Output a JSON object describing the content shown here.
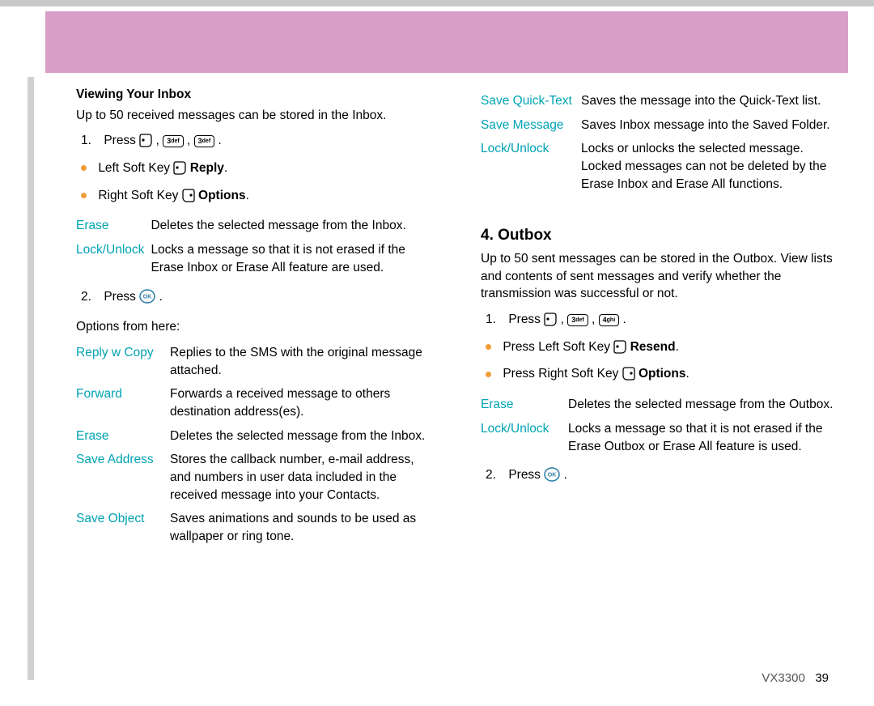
{
  "section1": {
    "heading": "Viewing Your Inbox",
    "intro": "Up to 50 received messages can be stored in the Inbox.",
    "step1_press": "Press ",
    "step1_num": "1.",
    "left_soft": "Left Soft Key ",
    "reply": "Reply",
    "right_soft": "Right Soft Key ",
    "options": "Options",
    "erase": "Erase",
    "erase_desc": "Deletes the selected message from the Inbox.",
    "lockunlock": "Lock/Unlock",
    "lockunlock_desc1": "Locks a message so that it is not erased if the",
    "lockunlock_desc2": "Erase Inbox or Erase All feature are used.",
    "step2_num": "2.",
    "step2_press": "Press ",
    "options_from": "Options from here:",
    "table": [
      {
        "t": "Reply w Copy",
        "d": "Replies to the SMS with the original message attached."
      },
      {
        "t": "Forward",
        "d": "Forwards a received message to others destination address(es)."
      },
      {
        "t": "Erase",
        "d": "Deletes the selected message from the Inbox."
      },
      {
        "t": "Save Address",
        "d": "Stores the callback number, e-mail address, and numbers in user data included in the received message into your Contacts."
      },
      {
        "t": "Save Object",
        "d": "Saves animations and sounds to be used as wallpaper or ring tone."
      }
    ]
  },
  "section1_cont": {
    "table": [
      {
        "t": "Save Quick-Text",
        "d": "Saves the message into the Quick-Text list."
      },
      {
        "t": "Save Message",
        "d": "Saves Inbox message into the Saved Folder."
      },
      {
        "t": "Lock/Unlock",
        "d": "Locks or unlocks the selected message. Locked messages can not be deleted by the Erase Inbox and Erase All functions."
      }
    ]
  },
  "section2": {
    "heading": "4. Outbox",
    "intro": "Up to 50 sent messages can be stored in the Outbox. View lists and contents of sent messages and verify whether the transmission was successful or not.",
    "step1_num": "1.",
    "step1_press": "Press ",
    "press_left": "Press Left Soft Key ",
    "resend": "Resend",
    "press_right": "Press Right Soft Key ",
    "options": "Options",
    "table": [
      {
        "t": "Erase",
        "d": "Deletes the selected message from the Outbox."
      },
      {
        "t": "Lock/Unlock",
        "d": "Locks a message so that it is not erased if the Erase Outbox or Erase All feature is used."
      }
    ],
    "step2_num": "2.",
    "step2_press": "Press "
  },
  "keys": {
    "k3": "3",
    "k3_sub": "def",
    "k4": "4",
    "k4_sub": "ghi"
  },
  "footer": {
    "model": "VX3300",
    "page": "39"
  }
}
